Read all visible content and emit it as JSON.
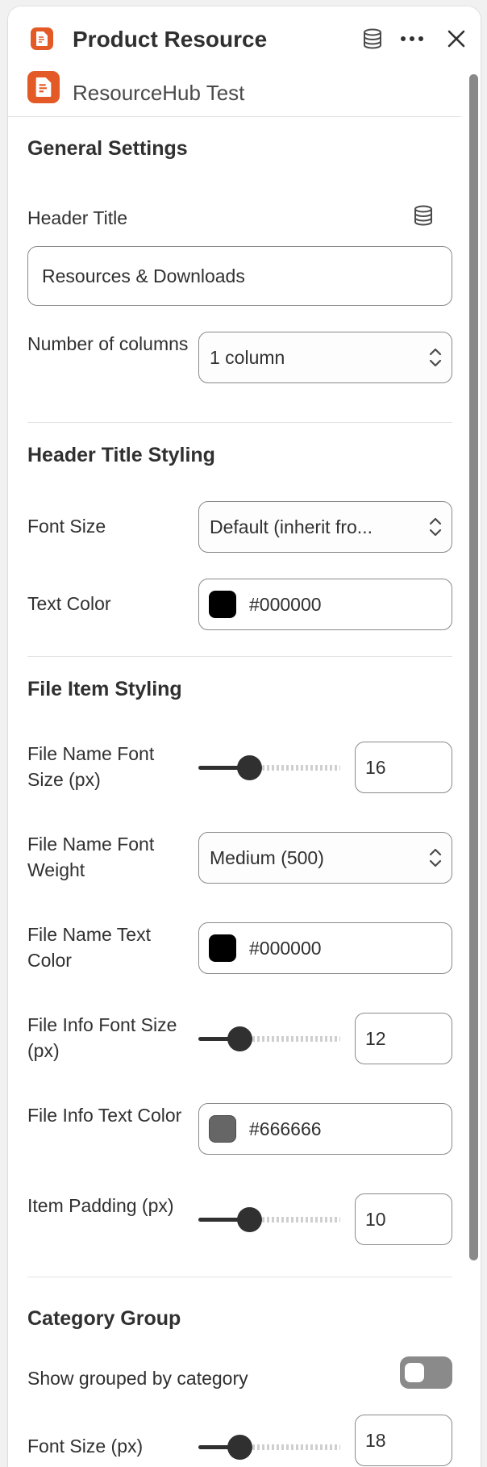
{
  "header": {
    "title": "Product Resource",
    "app_name": "ResourceHub Test",
    "icons": {
      "app": "document-app-icon",
      "database": "database-icon",
      "more": "more-horizontal-icon",
      "close": "close-icon"
    },
    "accent": "#e35a26"
  },
  "general": {
    "title": "General Settings",
    "header_title_label": "Header Title",
    "header_title_value": "Resources & Downloads",
    "columns_label": "Number of columns",
    "columns_value": "1 column"
  },
  "header_styling": {
    "title": "Header Title Styling",
    "font_size_label": "Font Size",
    "font_size_value": "Default (inherit fro...",
    "text_color_label": "Text Color",
    "text_color_value": "#000000",
    "text_color_swatch": "#000000"
  },
  "file_item": {
    "title": "File Item Styling",
    "name_size_label": "File Name Font Size (px)",
    "name_size_value": "16",
    "name_size_fraction": 0.36,
    "name_weight_label": "File Name Font Weight",
    "name_weight_value": "Medium (500)",
    "name_color_label": "File Name Text Color",
    "name_color_value": "#000000",
    "name_color_swatch": "#000000",
    "info_size_label": "File Info Font Size (px)",
    "info_size_value": "12",
    "info_size_fraction": 0.29,
    "info_color_label": "File Info Text Color",
    "info_color_value": "#666666",
    "info_color_swatch": "#666666",
    "padding_label": "Item Padding (px)",
    "padding_value": "10",
    "padding_fraction": 0.36
  },
  "category": {
    "title": "Category Group",
    "grouped_label": "Show grouped by category",
    "grouped_on": false,
    "font_size_label": "Font Size (px)",
    "font_size_value": "18",
    "font_size_fraction": 0.29
  }
}
